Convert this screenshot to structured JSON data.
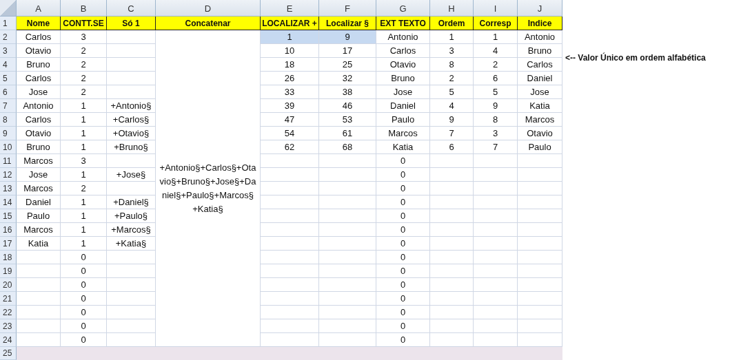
{
  "columns": [
    "A",
    "B",
    "C",
    "D",
    "E",
    "F",
    "G",
    "H",
    "I",
    "J"
  ],
  "header_row": {
    "n": "1",
    "cells": [
      "Nome",
      "CONTT.SE",
      "Só 1",
      "Concatenar",
      "LOCALIZAR +",
      "Localizar §",
      "EXT TEXTO",
      "Ordem",
      "Corresp",
      "Indice"
    ]
  },
  "merged_cell": {
    "text": "+Antonio§+Carlos§+Otavio§+Bruno§+Jose§+Daniel§+Paulo§+Marcos§+Katia§"
  },
  "rows": [
    {
      "n": "2",
      "cells": [
        {
          "text": "Carlos",
          "selected": false
        },
        {
          "text": "3",
          "selected": false
        },
        null,
        null,
        {
          "text": "1",
          "selected": true
        },
        {
          "text": "9",
          "selected": true
        },
        {
          "text": "Antonio",
          "selected": false
        },
        {
          "text": "1",
          "selected": false
        },
        {
          "text": "1",
          "selected": false
        },
        {
          "text": "Antonio",
          "selected": false
        }
      ]
    },
    {
      "n": "3",
      "cells": [
        "Otavio",
        "2",
        null,
        null,
        "10",
        "17",
        "Carlos",
        "3",
        "4",
        "Bruno"
      ]
    },
    {
      "n": "4",
      "cells": [
        "Bruno",
        "2",
        null,
        null,
        "18",
        "25",
        "Otavio",
        "8",
        "2",
        "Carlos"
      ]
    },
    {
      "n": "5",
      "cells": [
        "Carlos",
        "2",
        null,
        null,
        "26",
        "32",
        "Bruno",
        "2",
        "6",
        "Daniel"
      ]
    },
    {
      "n": "6",
      "cells": [
        "Jose",
        "2",
        null,
        null,
        "33",
        "38",
        "Jose",
        "5",
        "5",
        "Jose"
      ]
    },
    {
      "n": "7",
      "cells": [
        "Antonio",
        "1",
        "+Antonio§",
        null,
        "39",
        "46",
        "Daniel",
        "4",
        "9",
        "Katia"
      ]
    },
    {
      "n": "8",
      "cells": [
        "Carlos",
        "1",
        "+Carlos§",
        null,
        "47",
        "53",
        "Paulo",
        "9",
        "8",
        "Marcos"
      ]
    },
    {
      "n": "9",
      "cells": [
        "Otavio",
        "1",
        "+Otavio§",
        null,
        "54",
        "61",
        "Marcos",
        "7",
        "3",
        "Otavio"
      ]
    },
    {
      "n": "10",
      "cells": [
        "Bruno",
        "1",
        "+Bruno§",
        null,
        "62",
        "68",
        "Katia",
        "6",
        "7",
        "Paulo"
      ]
    },
    {
      "n": "11",
      "cells": [
        "Marcos",
        "3",
        null,
        null,
        null,
        null,
        "0",
        null,
        null,
        null
      ]
    },
    {
      "n": "12",
      "cells": [
        "Jose",
        "1",
        "+Jose§",
        null,
        null,
        null,
        "0",
        null,
        null,
        null
      ]
    },
    {
      "n": "13",
      "cells": [
        "Marcos",
        "2",
        null,
        null,
        null,
        null,
        "0",
        null,
        null,
        null
      ]
    },
    {
      "n": "14",
      "cells": [
        "Daniel",
        "1",
        "+Daniel§",
        null,
        null,
        null,
        "0",
        null,
        null,
        null
      ]
    },
    {
      "n": "15",
      "cells": [
        "Paulo",
        "1",
        "+Paulo§",
        null,
        null,
        null,
        "0",
        null,
        null,
        null
      ]
    },
    {
      "n": "16",
      "cells": [
        "Marcos",
        "1",
        "+Marcos§",
        null,
        null,
        null,
        "0",
        null,
        null,
        null
      ]
    },
    {
      "n": "17",
      "cells": [
        "Katia",
        "1",
        "+Katia§",
        null,
        null,
        null,
        "0",
        null,
        null,
        null
      ]
    },
    {
      "n": "18",
      "cells": [
        null,
        "0",
        null,
        null,
        null,
        null,
        "0",
        null,
        null,
        null
      ]
    },
    {
      "n": "19",
      "cells": [
        null,
        "0",
        null,
        null,
        null,
        null,
        "0",
        null,
        null,
        null
      ]
    },
    {
      "n": "20",
      "cells": [
        null,
        "0",
        null,
        null,
        null,
        null,
        "0",
        null,
        null,
        null
      ]
    },
    {
      "n": "21",
      "cells": [
        null,
        "0",
        null,
        null,
        null,
        null,
        "0",
        null,
        null,
        null
      ]
    },
    {
      "n": "22",
      "cells": [
        null,
        "0",
        null,
        null,
        null,
        null,
        "0",
        null,
        null,
        null
      ]
    },
    {
      "n": "23",
      "cells": [
        null,
        "0",
        null,
        null,
        null,
        null,
        "0",
        null,
        null,
        null
      ]
    },
    {
      "n": "24",
      "cells": [
        null,
        "0",
        null,
        null,
        null,
        null,
        "0",
        null,
        null,
        null
      ]
    }
  ],
  "blank_row": {
    "n": "25"
  },
  "annotation": "<--  Valor Único em ordem alfabética"
}
